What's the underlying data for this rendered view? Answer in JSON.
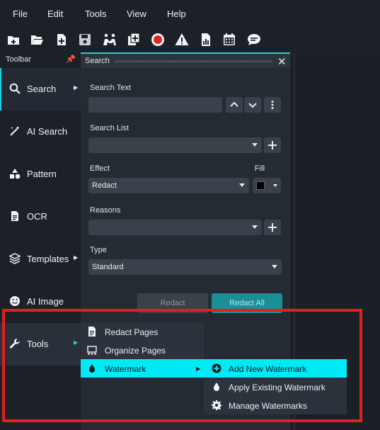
{
  "menubar": {
    "items": [
      "File",
      "Edit",
      "Tools",
      "View",
      "Help"
    ]
  },
  "toolbar_icons": [
    "new-file-icon",
    "open-folder-icon",
    "add-file-icon",
    "save-icon",
    "collaborate-icon",
    "copy-add-icon",
    "record-icon",
    "warning-icon",
    "report-icon",
    "calendar-icon",
    "chat-icon"
  ],
  "sidebar": {
    "title": "Toolbar",
    "items": [
      {
        "label": "Search",
        "icon": "search-icon",
        "has_arrow": true,
        "active": true
      },
      {
        "label": "AI Search",
        "icon": "magic-wand-icon",
        "has_arrow": false
      },
      {
        "label": "Pattern",
        "icon": "shapes-icon",
        "has_arrow": false
      },
      {
        "label": "OCR",
        "icon": "document-icon",
        "has_arrow": false
      },
      {
        "label": "Templates",
        "icon": "layers-icon",
        "has_arrow": true
      },
      {
        "label": "AI Image",
        "icon": "smiley-icon",
        "has_arrow": false
      },
      {
        "label": "Tools",
        "icon": "wrench-icon",
        "has_arrow": true
      }
    ]
  },
  "search_panel": {
    "title": "Search",
    "search_text_label": "Search Text",
    "search_text_value": "",
    "search_list_label": "Search List",
    "search_list_value": "",
    "effect_label": "Effect",
    "effect_value": "Redact",
    "fill_label": "Fill",
    "fill_color": "#000000",
    "reasons_label": "Reasons",
    "reasons_value": "",
    "type_label": "Type",
    "type_value": "Standard",
    "redact_button": "Redact",
    "redact_all_button": "Redact All"
  },
  "tools_submenu": {
    "items": [
      {
        "label": "Redact Pages",
        "icon": "document-icon"
      },
      {
        "label": "Organize Pages",
        "icon": "pages-icon"
      },
      {
        "label": "Watermark",
        "icon": "droplet-icon",
        "highlighted": true
      }
    ]
  },
  "watermark_submenu": {
    "items": [
      {
        "label": "Add New Watermark",
        "icon": "plus-circle-icon",
        "highlighted": true
      },
      {
        "label": "Apply Existing Watermark",
        "icon": "droplet-icon"
      },
      {
        "label": "Manage Watermarks",
        "icon": "gear-icon"
      }
    ]
  },
  "colors": {
    "accent": "#19d3e0",
    "highlight": "#00eaf6",
    "annotation": "#e0201e",
    "record": "#e02424"
  }
}
